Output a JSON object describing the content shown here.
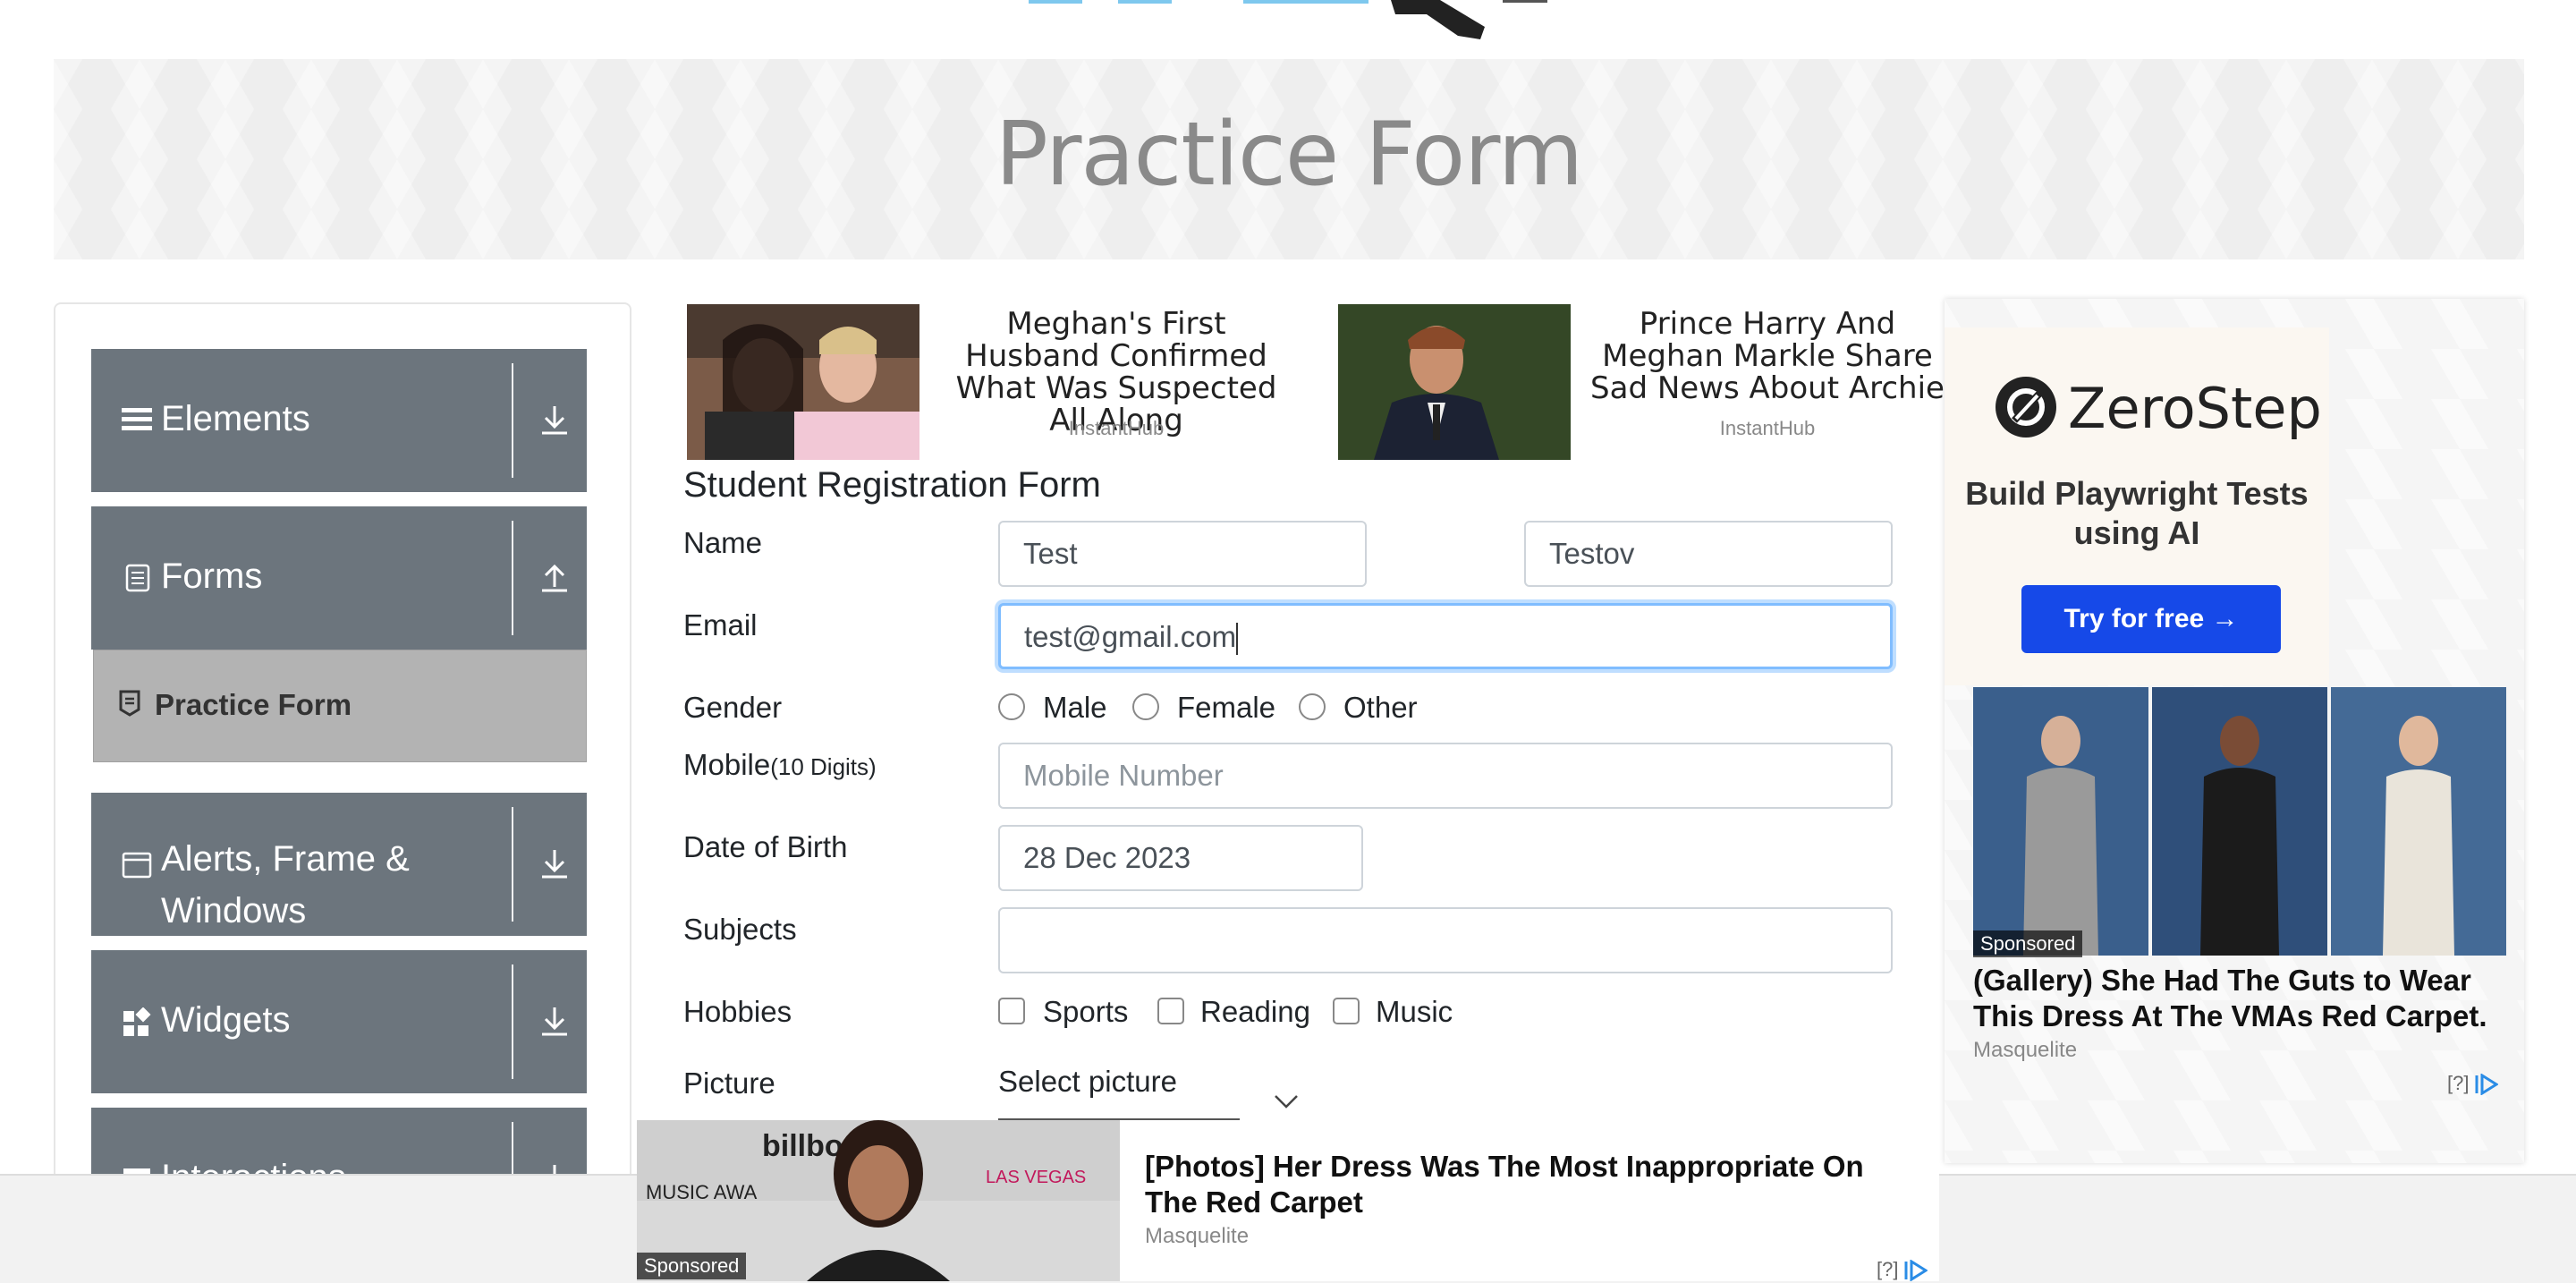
{
  "page": {
    "title": "Practice Form"
  },
  "sidebar": {
    "groups": [
      {
        "label": "Elements"
      },
      {
        "label": "Forms"
      },
      {
        "label": "Alerts, Frame &",
        "label2": "Windows"
      },
      {
        "label": "Widgets"
      },
      {
        "label": "Interactions"
      }
    ],
    "active_item": "Practice Form"
  },
  "top_ads": [
    {
      "title": "Meghan's First Husband Confirmed What Was Suspected All Along",
      "source": "InstantHub"
    },
    {
      "title": "Prince Harry And Meghan Markle Share Sad News About Archie",
      "source": "InstantHub"
    }
  ],
  "form": {
    "title": "Student Registration Form",
    "name_label": "Name",
    "first_name": "Test",
    "last_name": "Testov",
    "email_label": "Email",
    "email": "test@gmail.com",
    "gender_label": "Gender",
    "gender_options": [
      "Male",
      "Female",
      "Other"
    ],
    "mobile_label": "Mobile",
    "mobile_hint": "(10 Digits)",
    "mobile_placeholder": "Mobile Number",
    "dob_label": "Date of Birth",
    "dob": "28 Dec 2023",
    "subjects_label": "Subjects",
    "subjects": "",
    "hobbies_label": "Hobbies",
    "hobbies": [
      "Sports",
      "Reading",
      "Music"
    ],
    "picture_label": "Picture",
    "picture_button": "Select picture"
  },
  "right_ad": {
    "brand": "ZeroStep",
    "tagline": "Build Playwright Tests using AI",
    "cta": "Try for free →",
    "sponsored": "Sponsored",
    "title": "(Gallery) She Had The Guts to Wear This Dress At The VMAs Red Carpet.",
    "source": "Masquelite",
    "adchoices": "[?]"
  },
  "bottom_ad": {
    "sponsored": "Sponsored",
    "title": "[Photos] Her Dress Was The Most Inappropriate On The Red Carpet",
    "source": "Masquelite",
    "adchoices": "[?]"
  },
  "colors": {
    "sidebar_group": "#6c757d",
    "active_item": "#b3b3b3",
    "focus_border": "#80bdff",
    "cta": "#1649e8"
  }
}
